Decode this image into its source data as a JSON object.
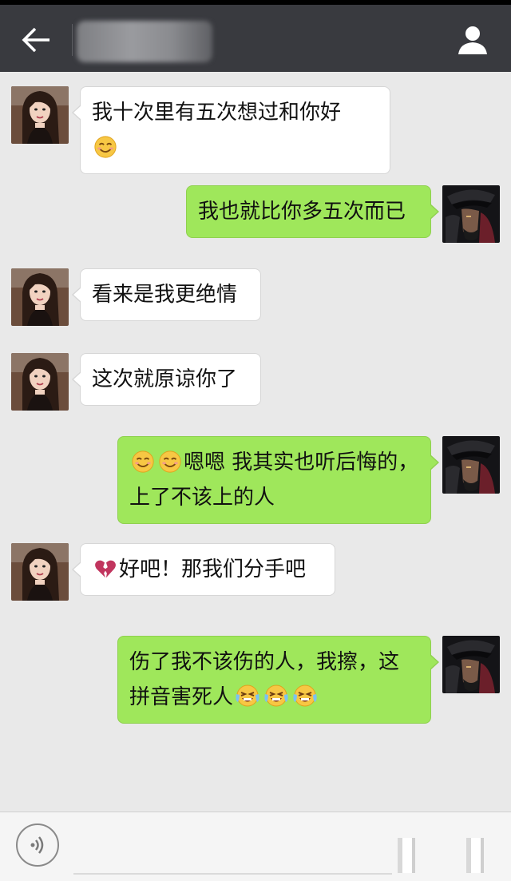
{
  "header": {
    "title": "",
    "back_icon": "arrow-left-icon",
    "profile_icon": "person-icon",
    "background": "#393a3f"
  },
  "messages": [
    {
      "side": "in",
      "text": "我十次里有五次想过和你好",
      "emoji_after": [
        "smile-icon"
      ]
    },
    {
      "side": "out",
      "text": "我也就比你多五次而已"
    },
    {
      "side": "in",
      "text": "看来是我更绝情"
    },
    {
      "side": "in",
      "text": "这次就原谅你了"
    },
    {
      "side": "out",
      "emoji_before": [
        "blush-smile-icon",
        "blush-smile-icon"
      ],
      "text": "嗯嗯 我其实也听后悔的，上了不该上的人"
    },
    {
      "side": "in",
      "emoji_before": [
        "broken-heart-icon"
      ],
      "text": "好吧！那我们分手吧"
    },
    {
      "side": "out",
      "text": "伤了我不该伤的人，我擦，这拼音害死人",
      "emoji_after": [
        "tears-of-joy-icon",
        "tears-of-joy-icon",
        "tears-of-joy-icon"
      ]
    }
  ],
  "input_bar": {
    "placeholder": "",
    "voice_icon": "voice-icon",
    "emoji_icon": "emoji-icon",
    "more_icon": "more-icon"
  },
  "colors": {
    "outgoing_bubble": "#9fe75b",
    "incoming_bubble": "#ffffff",
    "chat_background": "#e9e9e9"
  }
}
